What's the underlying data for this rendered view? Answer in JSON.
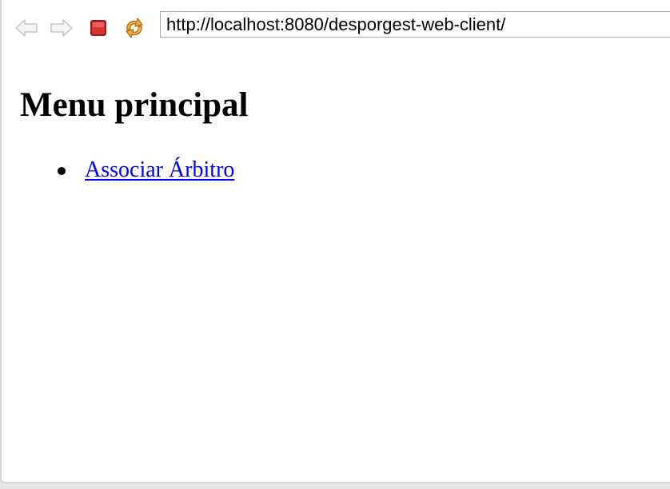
{
  "browser": {
    "url": "http://localhost:8080/desporgest-web-client/",
    "buttons": {
      "back": "back-arrow-icon",
      "forward": "forward-arrow-icon",
      "stop": "stop-icon",
      "refresh": "refresh-icon"
    }
  },
  "page": {
    "heading": "Menu principal",
    "menu_items": [
      {
        "label": "Associar Árbitro"
      }
    ]
  },
  "colors": {
    "link": "#0000ee",
    "stop_red": "#d32f2f",
    "refresh_orange": "#e8a030",
    "nav_gray": "#c8c8c8"
  }
}
